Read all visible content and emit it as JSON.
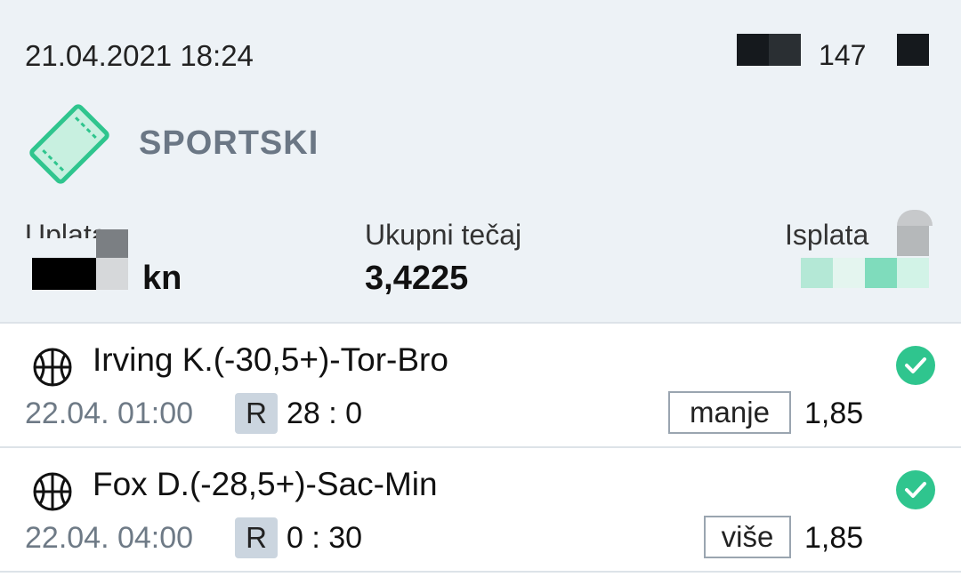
{
  "header": {
    "datetime": "21.04.2021 18:24",
    "ticket_id": "147",
    "ticket_type": "SPORTSKI"
  },
  "summary": {
    "stake_label": "Uplata",
    "stake_currency": "kn",
    "total_odds_label": "Ukupni tečaj",
    "total_odds_value": "3,4225",
    "payout_label": "Isplata"
  },
  "bets": [
    {
      "title": "Irving K.(-30,5+)-Tor-Bro",
      "time": "22.04. 01:00",
      "badge": "R",
      "score": "28 : 0",
      "pick": "manje",
      "odds": "1,85",
      "status": "won"
    },
    {
      "title": "Fox D.(-28,5+)-Sac-Min",
      "time": "22.04. 04:00",
      "badge": "R",
      "score": "0 : 30",
      "pick": "više",
      "odds": "1,85",
      "status": "won"
    }
  ],
  "colors": {
    "header_bg": "#edf2f6",
    "accent_green": "#2fc58e",
    "muted_text": "#6e7a86"
  },
  "icons": {
    "ticket": "ticket-icon",
    "sport": "basketball-icon",
    "status": "check-circle-icon"
  }
}
